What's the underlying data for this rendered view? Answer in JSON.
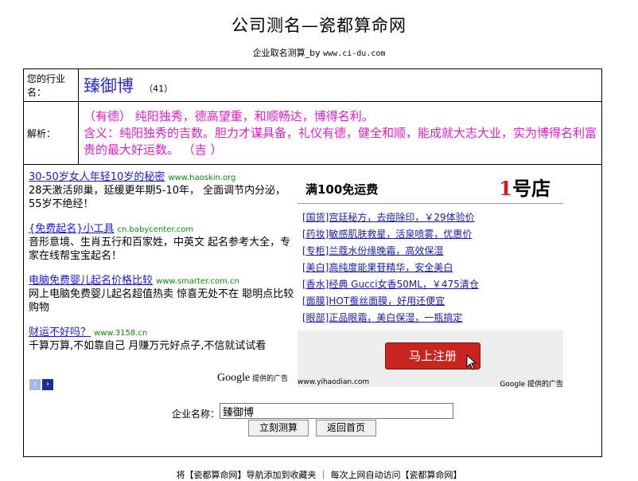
{
  "header": {
    "title": "公司测名—瓷都算命网",
    "subtitle_prefix": "企业取名测算_by",
    "subtitle_domain": "www.ci-du.com"
  },
  "result": {
    "name_label": "您的行业名：",
    "company_name": "臻御博",
    "stroke_count": "（41）",
    "analysis_label": "解析：",
    "analysis_line1": "（有德） 纯阳独秀，德高望重，和顺畅达，博得名利。",
    "analysis_line2": "含义：纯阳独秀的吉数。胆力才谋具备，礼仪有德，健全和顺，能成就大志大业，实为博得名利富贵的最大好运数。  （吉 ）"
  },
  "text_ads": [
    {
      "title": "30-50岁女人年轻10岁的秘密",
      "domain": "www.haoskin.org",
      "desc": "28天激活卵巢，延缓更年期5-10年， 全面调节内分泌，55岁不绝经！"
    },
    {
      "title": "{免费起名}小工具",
      "domain": "cn.babycenter.com",
      "desc": "音形意境、生肖五行和百家姓，中英文 起名参考大全，专家在线帮宝宝起名！"
    },
    {
      "title": "电脑免费婴儿起名价格比较",
      "domain": "www.smarter.com.cn",
      "desc": "网上电脑免费婴儿起名超值热卖 惊喜无处不在 聪明点比较购物"
    },
    {
      "title": "财运不好吗？",
      "domain": "www.3158.cn",
      "desc": "千算万算,不如靠自己 月赚万元好点子,不信就试试看"
    }
  ],
  "ad_nav": {
    "prev_icon": "‹",
    "next_icon": "›"
  },
  "google_credit": {
    "brand": "Google",
    "text": "提供的广告"
  },
  "banner": {
    "heading": "满100免运费",
    "logo_num": "1",
    "logo_text": "号店",
    "items": [
      "[国货]宫廷秘方，去痘除印，￥29体验价",
      "[药妆]敏感肌肤救星，活泉喷雾，优惠价",
      "[专柜]兰蔻水份缘晚霜，高效保湿",
      "[美白]高纯度能果苷精华，安全美白",
      "[香水]经典 Gucci女香50ML，￥475清仓",
      "[面膜]HOT蚕丝面膜，好用还便宜",
      "[眼部]正品眼霜，美白保湿，一瓶搞定"
    ],
    "register_label": "马上注册",
    "url": "www.yihaodian.com",
    "credit": "Google 提供的广告"
  },
  "form": {
    "label": "企业名称：",
    "input_value": "臻御博",
    "query_button": "立刻测算",
    "home_button": "返回首页"
  },
  "footer": {
    "text": "将【瓷都算命网】导航添加到收藏夹 ｜ 每次上网自动访问【瓷都算命网】"
  }
}
